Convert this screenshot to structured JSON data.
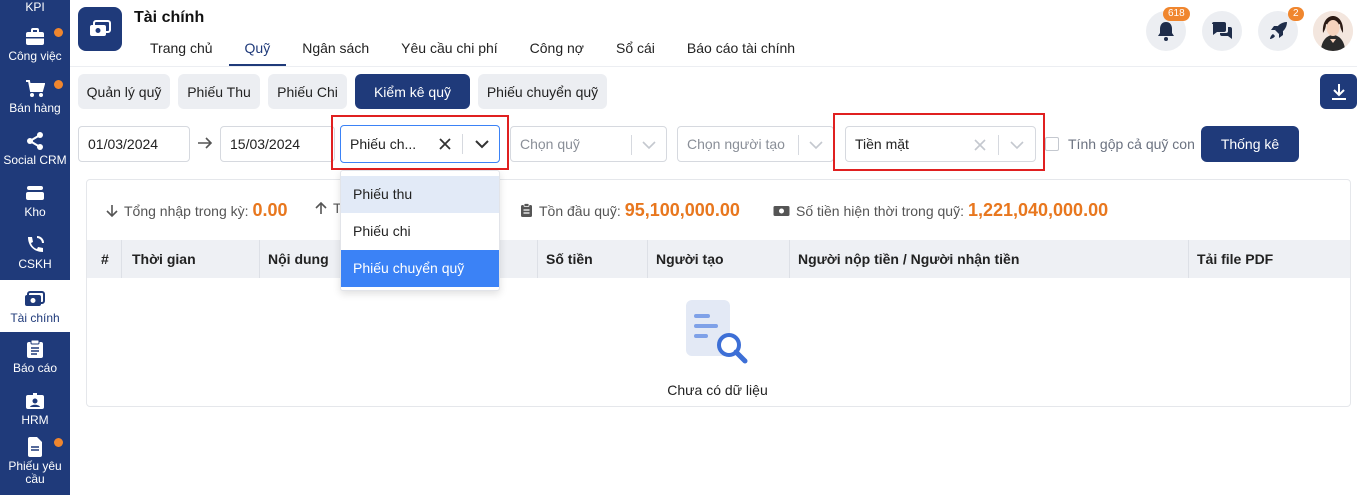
{
  "sidebar": {
    "items": [
      {
        "label": "KPI",
        "icon": "kpi-icon"
      },
      {
        "label": "Công việc",
        "icon": "briefcase-icon"
      },
      {
        "label": "Bán hàng",
        "icon": "cart-icon"
      },
      {
        "label": "Social CRM",
        "icon": "share-icon"
      },
      {
        "label": "Kho",
        "icon": "warehouse-icon"
      },
      {
        "label": "CSKH",
        "icon": "phone-icon"
      },
      {
        "label": "Tài chính",
        "icon": "finance-icon"
      },
      {
        "label": "Báo cáo",
        "icon": "clipboard-icon"
      },
      {
        "label": "HRM",
        "icon": "id-card-icon"
      },
      {
        "label": "Phiếu yêu cầu",
        "icon": "document-icon"
      }
    ]
  },
  "header": {
    "title": "Tài chính",
    "tabs": [
      "Trang chủ",
      "Quỹ",
      "Ngân sách",
      "Yêu cầu chi phí",
      "Công nợ",
      "Sổ cái",
      "Báo cáo tài chính"
    ],
    "active_tab": "Quỹ",
    "notification_count": "618",
    "rocket_count": "2"
  },
  "subtabs": [
    "Quản lý quỹ",
    "Phiếu Thu",
    "Phiếu Chi",
    "Kiểm kê quỹ",
    "Phiếu chuyển quỹ"
  ],
  "filters": {
    "date_from": "01/03/2024",
    "date_to": "15/03/2024",
    "voucher_type": "Phiếu ch...",
    "fund_placeholder": "Chọn quỹ",
    "creator_placeholder": "Chọn người tạo",
    "payment_method": "Tiền mặt",
    "include_child_label": "Tính gộp cả quỹ con",
    "stat_button": "Thống kê"
  },
  "summary": {
    "total_in_label": "Tổng nhập trong kỳ:",
    "total_in_value": "0.00",
    "total_out_label": "T",
    "opening_label": "Tồn đầu quỹ:",
    "opening_value": "95,100,000.00",
    "current_label": "Số tiền hiện thời trong quỹ:",
    "current_value": "1,221,040,000.00"
  },
  "table": {
    "columns": [
      "#",
      "Thời gian",
      "Nội dung",
      "Số tiền",
      "Người tạo",
      "Người nộp tiền / Người nhận tiền",
      "Tải file PDF"
    ],
    "empty_text": "Chưa có dữ liệu"
  },
  "dropdown": {
    "options": [
      "Phiếu thu",
      "Phiếu chi",
      "Phiếu chuyển quỹ"
    ]
  },
  "colors": {
    "primary": "#1f3a7a",
    "accent": "#e8771e",
    "highlight_border": "#e02020",
    "selected_option": "#3b82f6"
  }
}
